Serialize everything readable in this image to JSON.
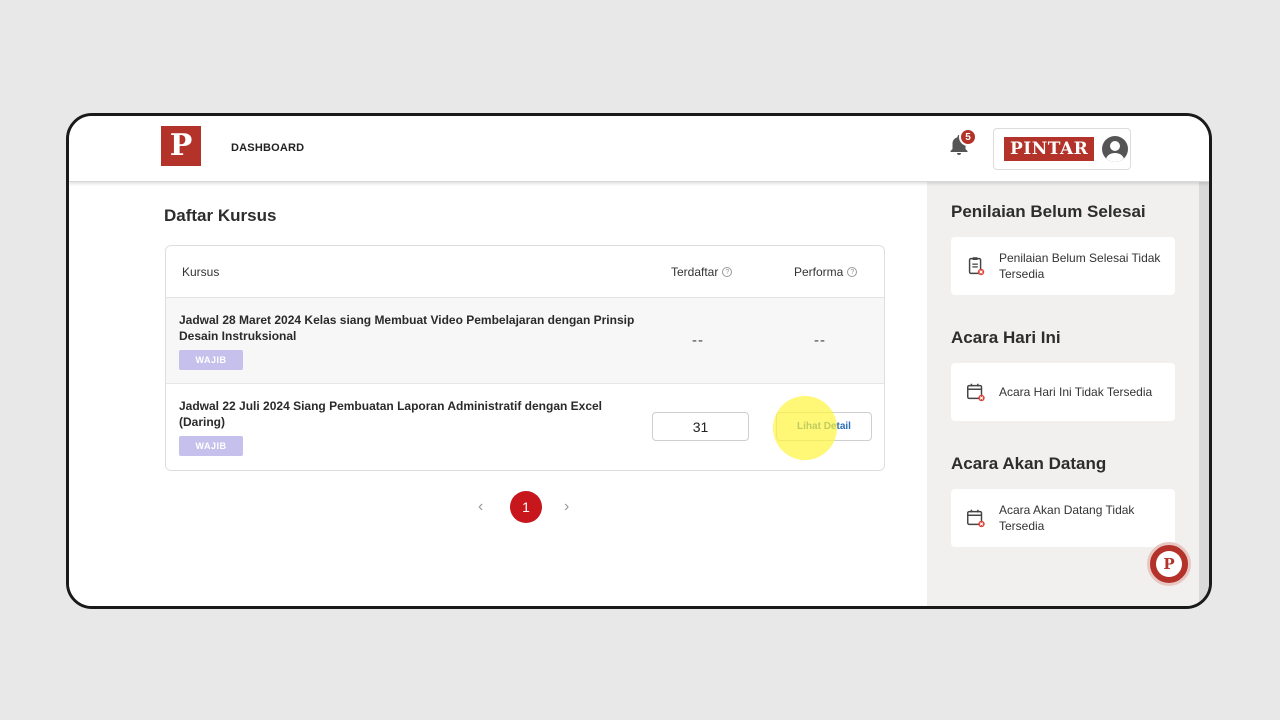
{
  "header": {
    "logo_letter": "P",
    "nav_label": "DASHBOARD",
    "notification_count": "5",
    "brand_name": "PINTAR"
  },
  "main": {
    "title": "Daftar Kursus",
    "table": {
      "columns": [
        "Kursus",
        "Terdaftar",
        "Performa"
      ],
      "rows": [
        {
          "title": "Jadwal 28 Maret 2024 Kelas siang Membuat Video Pembelajaran dengan Prinsip Desain Instruksional",
          "badge": "WAJIB",
          "enrolled": "--",
          "performance": "--"
        },
        {
          "title": "Jadwal 22 Juli 2024 Siang Pembuatan Laporan Administratif dengan Excel (Daring)",
          "badge": "WAJIB",
          "enrolled": "31",
          "performance_button": "Lihat Detail"
        }
      ]
    },
    "pagination": {
      "prev": "‹",
      "current": "1",
      "next": "›"
    }
  },
  "sidebar": {
    "sections": [
      {
        "title": "Penilaian Belum Selesai",
        "message": "Penilaian Belum Selesai Tidak Tersedia",
        "icon": "clipboard-icon"
      },
      {
        "title": "Acara Hari Ini",
        "message": "Acara Hari Ini Tidak Tersedia",
        "icon": "calendar-icon"
      },
      {
        "title": "Acara Akan Datang",
        "message": "Acara Akan Datang Tidak Tersedia",
        "icon": "calendar-icon"
      }
    ]
  },
  "chat": {
    "letter": "P"
  },
  "colors": {
    "brand": "#b3332a",
    "pagination_active": "#c8161d",
    "badge": "#c5c1ec",
    "link": "#2a6fb5",
    "sidebar_bg": "#f1f0ef"
  }
}
